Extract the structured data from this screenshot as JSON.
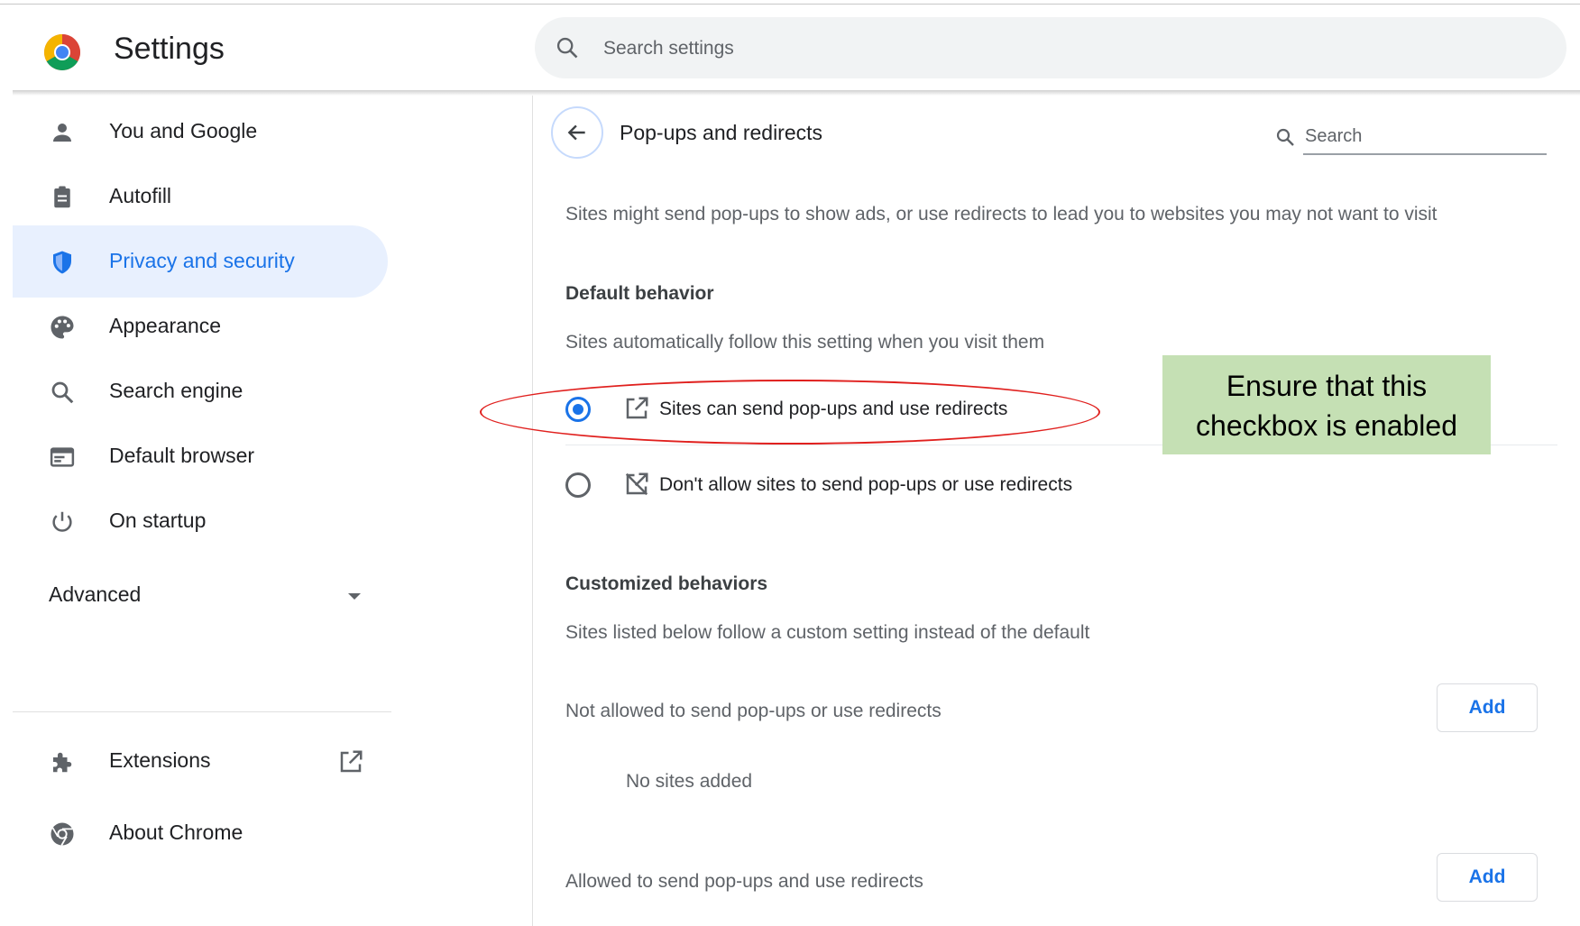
{
  "app": {
    "title": "Settings",
    "search_placeholder": "Search settings"
  },
  "sidebar": {
    "items": [
      {
        "label": "You and Google",
        "icon": "person-icon"
      },
      {
        "label": "Autofill",
        "icon": "clipboard-icon"
      },
      {
        "label": "Privacy and security",
        "icon": "shield-icon",
        "active": true
      },
      {
        "label": "Appearance",
        "icon": "palette-icon"
      },
      {
        "label": "Search engine",
        "icon": "search-icon"
      },
      {
        "label": "Default browser",
        "icon": "browser-window-icon"
      },
      {
        "label": "On startup",
        "icon": "power-icon"
      }
    ],
    "advanced_label": "Advanced",
    "extensions_label": "Extensions",
    "about_label": "About Chrome"
  },
  "page": {
    "title": "Pop-ups and redirects",
    "search_placeholder": "Search",
    "description": "Sites might send pop-ups to show ads, or use redirects to lead you to websites you may not want to visit",
    "default_heading": "Default behavior",
    "default_sub": "Sites automatically follow this setting when you visit them",
    "options": [
      {
        "label": "Sites can send pop-ups and use redirects",
        "selected": true,
        "icon": "open-in-new-icon"
      },
      {
        "label": "Don't allow sites to send pop-ups or use redirects",
        "selected": false,
        "icon": "blocked-popup-icon"
      }
    ],
    "custom_heading": "Customized behaviors",
    "custom_sub": "Sites listed below follow a custom setting instead of the default",
    "not_allowed_label": "Not allowed to send pop-ups or use redirects",
    "no_sites": "No sites added",
    "allowed_label": "Allowed to send pop-ups and use redirects",
    "add_label": "Add"
  },
  "annotation": {
    "text": "Ensure that this checkbox is enabled",
    "callout_color": "#c5e0b4",
    "oval_color": "#e0201e"
  },
  "colors": {
    "accent": "#1a73e8",
    "active_bg": "#e8f0fe",
    "search_bg": "#f1f3f4"
  }
}
